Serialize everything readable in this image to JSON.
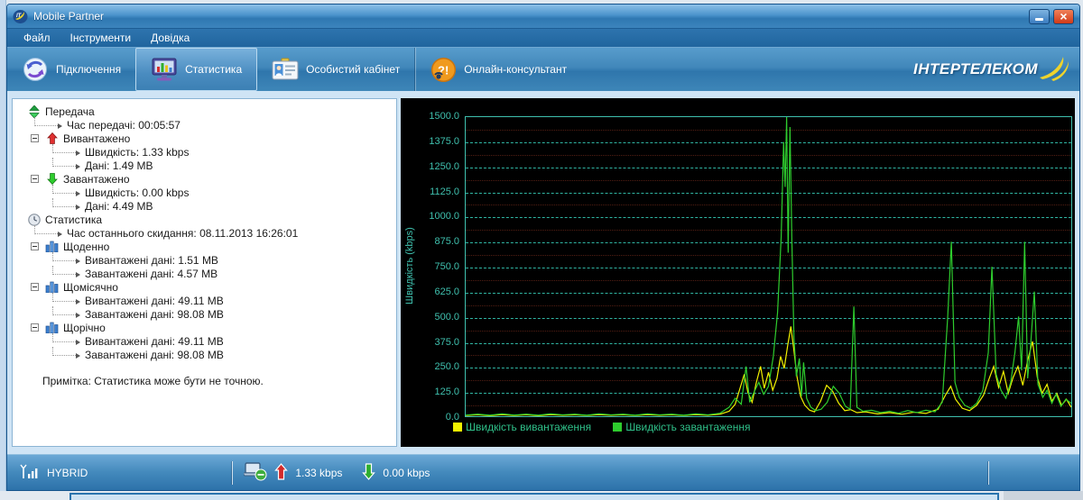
{
  "window": {
    "title": "Mobile Partner"
  },
  "menu": {
    "items": [
      {
        "id": "file",
        "label": "Файл"
      },
      {
        "id": "tools",
        "label": "Інструменти"
      },
      {
        "id": "help",
        "label": "Довідка"
      }
    ]
  },
  "toolbar": {
    "buttons": [
      {
        "id": "connection",
        "label": "Підключення",
        "icon": "sync-icon",
        "active": false
      },
      {
        "id": "statistics",
        "label": "Статистика",
        "icon": "statistics-icon",
        "active": true
      },
      {
        "id": "personal-cabinet",
        "label": "Особистий кабінет",
        "icon": "id-card-icon",
        "active": false
      },
      {
        "id": "online-consultant",
        "label": "Онлайн-консультант",
        "icon": "online-consultant-icon",
        "active": false
      }
    ],
    "brand": "ІНТЕРТЕЛЕКОМ"
  },
  "tree": {
    "rows": [
      {
        "type": "root",
        "icon": "transfer-updown-icon",
        "label": "Передача"
      },
      {
        "type": "leaf1",
        "label": "Час передачі: 00:05:57"
      },
      {
        "type": "group",
        "icon": "upload-arrow-icon",
        "label": "Вивантажено"
      },
      {
        "type": "leaf2",
        "label": "Швидкість: 1.33 kbps"
      },
      {
        "type": "leaf2",
        "label": "Дані: 1.49 MB"
      },
      {
        "type": "group",
        "icon": "download-arrow-icon",
        "label": "Завантажено"
      },
      {
        "type": "leaf2",
        "label": "Швидкість: 0.00 kbps"
      },
      {
        "type": "leaf2",
        "label": "Дані: 4.49 MB"
      },
      {
        "type": "root",
        "icon": "clock-icon",
        "label": "Статистика"
      },
      {
        "type": "leaf1",
        "label": "Час останнього скидання: 08.11.2013 16:26:01"
      },
      {
        "type": "group",
        "icon": "bar-chart-icon",
        "label": "Щоденно"
      },
      {
        "type": "leaf2",
        "label": "Вивантажені дані: 1.51 MB"
      },
      {
        "type": "leaf2",
        "label": "Завантажені дані: 4.57 MB"
      },
      {
        "type": "group",
        "icon": "bar-chart-icon",
        "label": "Щомісячно"
      },
      {
        "type": "leaf2",
        "label": "Вивантажені дані: 49.11 MB"
      },
      {
        "type": "leaf2",
        "label": "Завантажені дані: 98.08 MB"
      },
      {
        "type": "group",
        "icon": "bar-chart-icon",
        "label": "Щорічно"
      },
      {
        "type": "leaf2",
        "label": "Вивантажені дані: 49.11 MB"
      },
      {
        "type": "leaf2",
        "label": "Завантажені дані: 98.08 MB"
      }
    ],
    "note": "Примітка: Статистика може бути не точною."
  },
  "chart_data": {
    "type": "line",
    "ylabel": "Швидкість (kbps)",
    "ylim": [
      0,
      1500
    ],
    "y_ticks": [
      0,
      125,
      250,
      375,
      500,
      625,
      750,
      875,
      1000,
      1125,
      1250,
      1375,
      1500
    ],
    "x_range_percent": [
      0,
      100
    ],
    "grid": "dashed horizontal",
    "legend_position": "bottom",
    "background_color": "#000000",
    "axis_color": "#3fc0ae",
    "series": [
      {
        "name": "Швидкість вивантаження",
        "color": "#f2f200",
        "points": [
          [
            0,
            4
          ],
          [
            2,
            7
          ],
          [
            4,
            3
          ],
          [
            6,
            8
          ],
          [
            8,
            4
          ],
          [
            10,
            7
          ],
          [
            12,
            3
          ],
          [
            14,
            8
          ],
          [
            16,
            5
          ],
          [
            18,
            7
          ],
          [
            20,
            4
          ],
          [
            22,
            8
          ],
          [
            24,
            5
          ],
          [
            26,
            7
          ],
          [
            28,
            4
          ],
          [
            30,
            8
          ],
          [
            32,
            5
          ],
          [
            34,
            7
          ],
          [
            36,
            4
          ],
          [
            38,
            8
          ],
          [
            40,
            5
          ],
          [
            42,
            10
          ],
          [
            43.5,
            25
          ],
          [
            44.5,
            60
          ],
          [
            45.3,
            140
          ],
          [
            46,
            210
          ],
          [
            46.6,
            120
          ],
          [
            47.3,
            70
          ],
          [
            48,
            170
          ],
          [
            48.7,
            250
          ],
          [
            49.3,
            140
          ],
          [
            50,
            220
          ],
          [
            50.7,
            130
          ],
          [
            51.4,
            190
          ],
          [
            52,
            300
          ],
          [
            52.6,
            240
          ],
          [
            53.2,
            360
          ],
          [
            53.7,
            450
          ],
          [
            54.2,
            330
          ],
          [
            54.7,
            200
          ],
          [
            55.3,
            100
          ],
          [
            56,
            55
          ],
          [
            56.8,
            30
          ],
          [
            57.6,
            22
          ],
          [
            58.6,
            75
          ],
          [
            59.6,
            155
          ],
          [
            60.6,
            125
          ],
          [
            61.6,
            65
          ],
          [
            62.6,
            28
          ],
          [
            63.6,
            33
          ],
          [
            64.6,
            18
          ],
          [
            66,
            22
          ],
          [
            68,
            12
          ],
          [
            70,
            18
          ],
          [
            72,
            10
          ],
          [
            74,
            20
          ],
          [
            76,
            14
          ],
          [
            78,
            35
          ],
          [
            79.3,
            110
          ],
          [
            80.1,
            150
          ],
          [
            80.9,
            85
          ],
          [
            82,
            40
          ],
          [
            83.2,
            28
          ],
          [
            84.4,
            55
          ],
          [
            85.5,
            105
          ],
          [
            86.4,
            185
          ],
          [
            87.2,
            250
          ],
          [
            88,
            145
          ],
          [
            88.8,
            225
          ],
          [
            89.6,
            115
          ],
          [
            90.4,
            195
          ],
          [
            91.2,
            250
          ],
          [
            92,
            155
          ],
          [
            92.8,
            280
          ],
          [
            93.6,
            375
          ],
          [
            94.4,
            195
          ],
          [
            95.2,
            115
          ],
          [
            96,
            160
          ],
          [
            96.8,
            75
          ],
          [
            97.6,
            115
          ],
          [
            98.4,
            55
          ],
          [
            99.2,
            85
          ],
          [
            100,
            45
          ]
        ]
      },
      {
        "name": "Швидкість завантаження",
        "color": "#2ecc2e",
        "points": [
          [
            0,
            6
          ],
          [
            2,
            10
          ],
          [
            4,
            5
          ],
          [
            6,
            12
          ],
          [
            8,
            6
          ],
          [
            10,
            10
          ],
          [
            12,
            5
          ],
          [
            14,
            12
          ],
          [
            16,
            7
          ],
          [
            18,
            10
          ],
          [
            20,
            5
          ],
          [
            22,
            12
          ],
          [
            24,
            7
          ],
          [
            26,
            10
          ],
          [
            28,
            5
          ],
          [
            30,
            12
          ],
          [
            32,
            7
          ],
          [
            34,
            10
          ],
          [
            36,
            5
          ],
          [
            38,
            12
          ],
          [
            40,
            7
          ],
          [
            42,
            15
          ],
          [
            43.5,
            45
          ],
          [
            44.5,
            90
          ],
          [
            45.5,
            60
          ],
          [
            46.3,
            250
          ],
          [
            46.9,
            70
          ],
          [
            47.6,
            120
          ],
          [
            48.4,
            170
          ],
          [
            49.2,
            110
          ],
          [
            50,
            150
          ],
          [
            50.8,
            300
          ],
          [
            51.5,
            520
          ],
          [
            52.1,
            900
          ],
          [
            52.5,
            1375
          ],
          [
            52.75,
            1150
          ],
          [
            53,
            1500
          ],
          [
            53.25,
            820
          ],
          [
            53.55,
            1450
          ],
          [
            53.85,
            900
          ],
          [
            54.2,
            400
          ],
          [
            54.6,
            200
          ],
          [
            55.1,
            290
          ],
          [
            55.45,
            100
          ],
          [
            55.8,
            270
          ],
          [
            56.3,
            90
          ],
          [
            57,
            45
          ],
          [
            57.8,
            28
          ],
          [
            58.7,
            35
          ],
          [
            59.7,
            70
          ],
          [
            60.7,
            150
          ],
          [
            61.7,
            115
          ],
          [
            62.7,
            50
          ],
          [
            63.5,
            35
          ],
          [
            64.1,
            550
          ],
          [
            64.6,
            45
          ],
          [
            65.6,
            25
          ],
          [
            67,
            30
          ],
          [
            68.5,
            18
          ],
          [
            70,
            25
          ],
          [
            71.5,
            15
          ],
          [
            73,
            28
          ],
          [
            74.5,
            18
          ],
          [
            76,
            30
          ],
          [
            77.5,
            22
          ],
          [
            78.7,
            70
          ],
          [
            79.6,
            500
          ],
          [
            80.2,
            875
          ],
          [
            80.8,
            170
          ],
          [
            81.5,
            95
          ],
          [
            82.4,
            55
          ],
          [
            83.4,
            40
          ],
          [
            84.4,
            65
          ],
          [
            85.4,
            130
          ],
          [
            86.3,
            320
          ],
          [
            86.9,
            750
          ],
          [
            87.6,
            210
          ],
          [
            88.4,
            130
          ],
          [
            89.2,
            90
          ],
          [
            90,
            170
          ],
          [
            90.7,
            320
          ],
          [
            91.3,
            500
          ],
          [
            91.8,
            230
          ],
          [
            92.3,
            875
          ],
          [
            92.8,
            190
          ],
          [
            93.3,
            360
          ],
          [
            93.9,
            625
          ],
          [
            94.5,
            160
          ],
          [
            95.3,
            95
          ],
          [
            96,
            130
          ],
          [
            96.8,
            65
          ],
          [
            97.5,
            110
          ],
          [
            98.3,
            50
          ],
          [
            99.1,
            85
          ],
          [
            100,
            65
          ]
        ]
      }
    ]
  },
  "statusbar": {
    "network_mode": "HYBRID",
    "upload_speed": "1.33 kbps",
    "download_speed": "0.00 kbps"
  }
}
